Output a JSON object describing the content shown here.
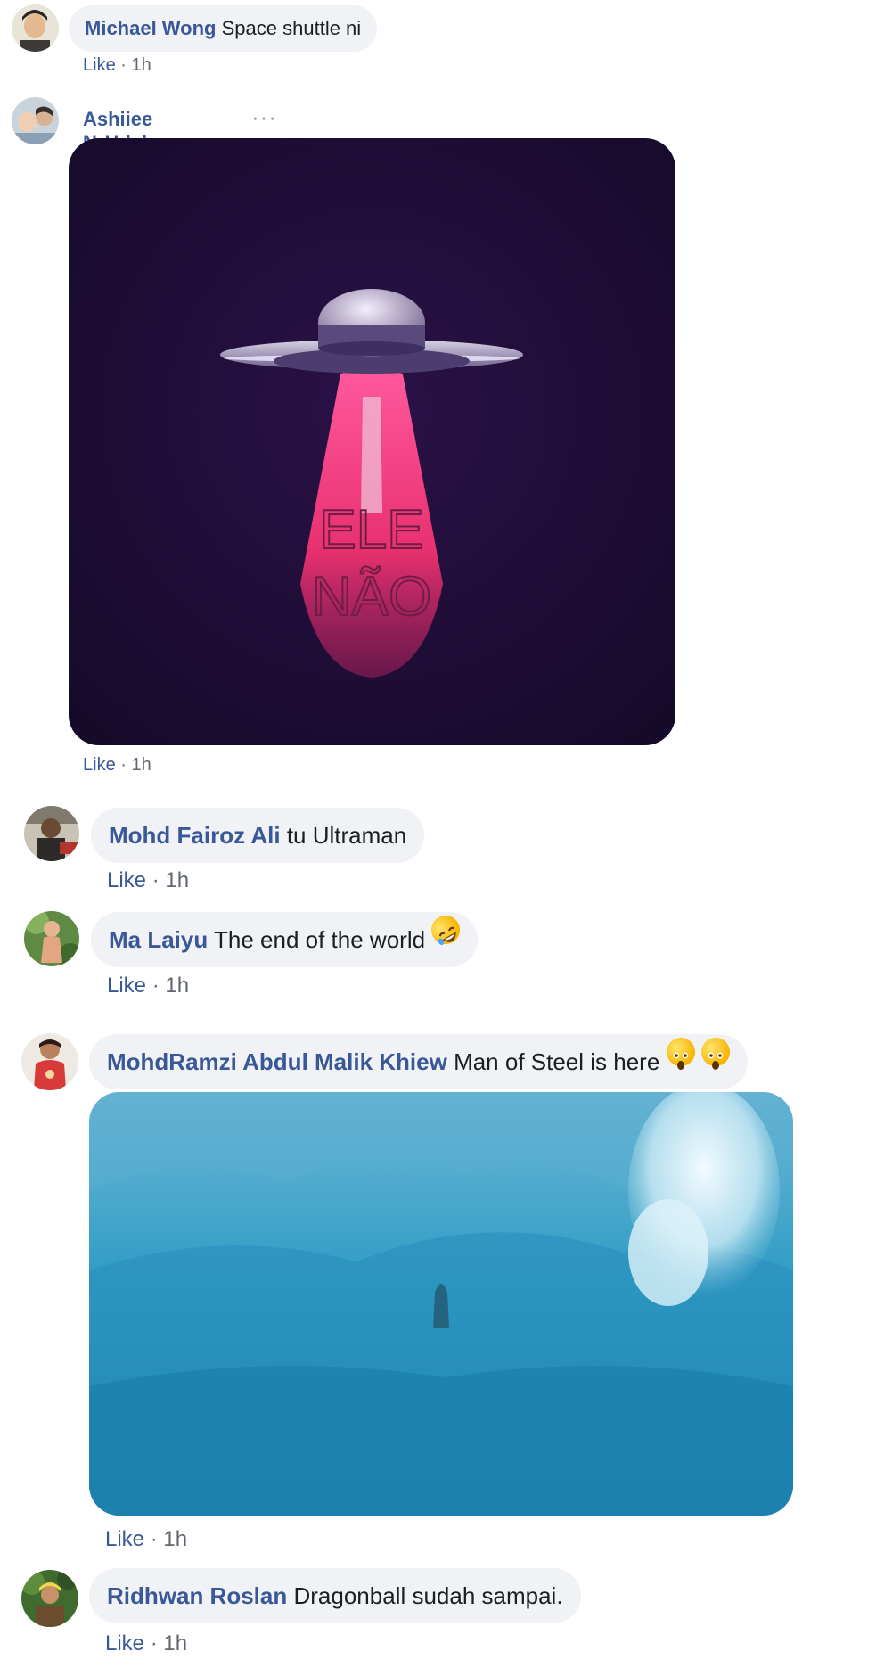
{
  "comments": [
    {
      "author": "Michael Wong",
      "text": "Space shuttle ni",
      "like": "Like",
      "sep": "·",
      "time": "1h"
    },
    {
      "author": "Ashiiee NrHdyh",
      "more": "···",
      "image_text": [
        "ELE",
        "NÃO"
      ],
      "like": "Like",
      "sep": "·",
      "time": "1h"
    },
    {
      "author": "Mohd Fairoz Ali",
      "text": "tu Ultraman",
      "like": "Like",
      "sep": "·",
      "time": "1h"
    },
    {
      "author": "Ma Laiyu",
      "text": "The end of the world",
      "emoji": "rolling-on-floor-laughing",
      "like": "Like",
      "sep": "·",
      "time": "1h"
    },
    {
      "author": "MohdRamzi Abdul Malik Khiew",
      "text": "Man of Steel is here",
      "emoji": "astonished-face",
      "like": "Like",
      "sep": "·",
      "time": "1h"
    },
    {
      "author": "Ridhwan Roslan",
      "text": "Dragonball sudah sampai.",
      "like": "Like",
      "sep": "·",
      "time": "1h"
    }
  ],
  "colors": {
    "author": "#385898",
    "bubble": "#f0f2f5",
    "meta_time": "#606770"
  }
}
